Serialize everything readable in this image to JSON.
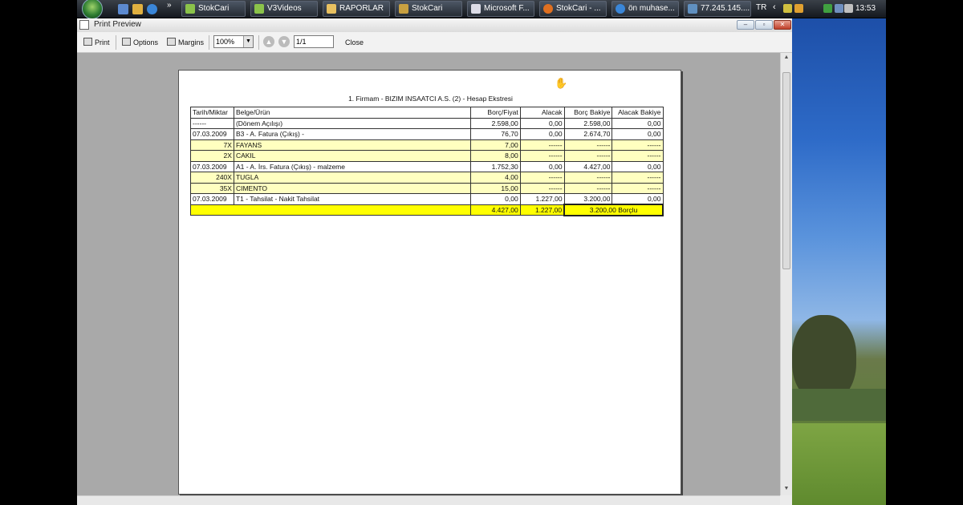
{
  "taskbar": {
    "tasks": [
      "StokCari",
      "V3Videos",
      "RAPORLAR",
      "StokCari",
      "Microsoft F...",
      "StokCari - ...",
      "ön muhase...",
      "77.245.145...."
    ],
    "language": "TR",
    "clock": "13:53"
  },
  "window": {
    "title": "Print Preview",
    "toolbar": {
      "print": "Print",
      "options": "Options",
      "margins": "Margins",
      "zoom": "100%",
      "page": "1/1",
      "close": "Close"
    }
  },
  "report": {
    "title": "1. Firmam - BIZIM INSAATCI A.S. (2) - Hesap Ekstresi",
    "columns": [
      "Tarih/Miktar",
      "Belge/Ürün",
      "Borç/Fiyat",
      "Alacak",
      "Borç Bakiye",
      "Alacak Bakiye"
    ],
    "rows": [
      {
        "type": "doc",
        "c0": "------",
        "c1": "(Dönem Açılışı)",
        "c2": "2.598,00",
        "c3": "0,00",
        "c4": "2.598,00",
        "c5": "0,00"
      },
      {
        "type": "doc",
        "c0": "07.03.2009",
        "c1": "B3 - A. Fatura (Çıkış) -",
        "c2": "76,70",
        "c3": "0,00",
        "c4": "2.674,70",
        "c5": "0,00"
      },
      {
        "type": "item",
        "c0": "7X",
        "c1": "FAYANS",
        "c2": "7,00",
        "c3": "------",
        "c4": "------",
        "c5": "------"
      },
      {
        "type": "item",
        "c0": "2X",
        "c1": "CAKIL",
        "c2": "8,00",
        "c3": "------",
        "c4": "------",
        "c5": "------"
      },
      {
        "type": "doc",
        "c0": "07.03.2009",
        "c1": "A1 - A. İrs. Fatura (Çıkış) - malzeme",
        "c2": "1.752,30",
        "c3": "0,00",
        "c4": "4.427,00",
        "c5": "0,00"
      },
      {
        "type": "item",
        "c0": "240X",
        "c1": "TUGLA",
        "c2": "4,00",
        "c3": "------",
        "c4": "------",
        "c5": "------"
      },
      {
        "type": "item",
        "c0": "35X",
        "c1": "CIMENTO",
        "c2": "15,00",
        "c3": "------",
        "c4": "------",
        "c5": "------"
      },
      {
        "type": "doc",
        "c0": "07.03.2009",
        "c1": "T1 - Tahsilat - Nakit Tahsilat",
        "c2": "0,00",
        "c3": "1.227,00",
        "c4": "3.200,00",
        "c5": "0,00"
      }
    ],
    "totals": {
      "debit": "4.427,00",
      "credit": "1.227,00",
      "balance": "3.200,00 Borçlu"
    }
  }
}
